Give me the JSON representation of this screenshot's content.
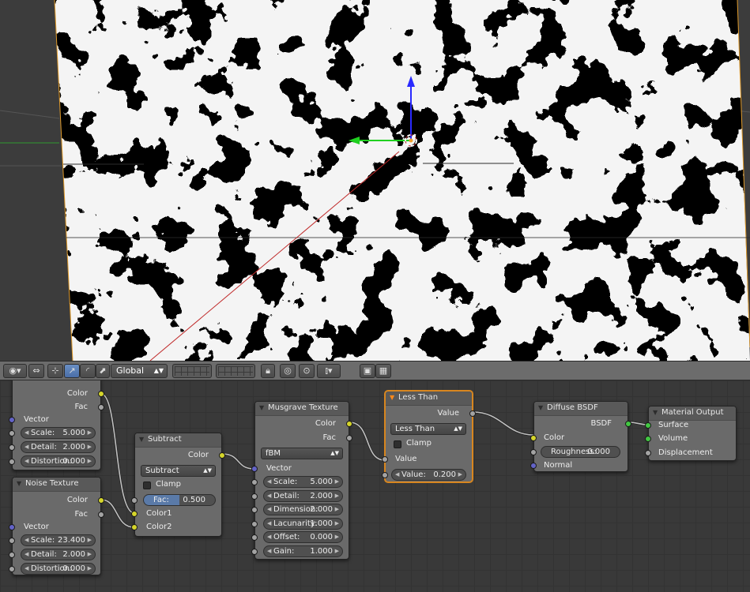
{
  "toolbar": {
    "orientation": "Global",
    "icons": [
      "viewport-shading-icon",
      "pivot-icon",
      "manipulator-toggle-icon",
      "translate-icon",
      "rotate-icon",
      "scale-icon",
      "layers-icon",
      "lock-icon",
      "proportional-edit-icon",
      "snap-icon",
      "render-icon",
      "anim-render-icon"
    ]
  },
  "nodes": {
    "noise1": {
      "title": "",
      "out_color": "Color",
      "out_fac": "Fac",
      "in_vector": "Vector",
      "scale_label": "Scale:",
      "scale": "5.000",
      "detail_label": "Detail:",
      "detail": "2.000",
      "distortion_label": "Distortion:",
      "distortion": "0.000"
    },
    "noise2": {
      "title": "Noise Texture",
      "out_color": "Color",
      "out_fac": "Fac",
      "in_vector": "Vector",
      "scale_label": "Scale:",
      "scale": "23.400",
      "detail_label": "Detail:",
      "detail": "2.000",
      "distortion_label": "Distortion:",
      "distortion": "0.000"
    },
    "subtract": {
      "title": "Subtract",
      "out_color": "Color",
      "mode": "Subtract",
      "clamp": "Clamp",
      "fac_label": "Fac:",
      "fac": "0.500",
      "in_color1": "Color1",
      "in_color2": "Color2"
    },
    "musgrave": {
      "title": "Musgrave Texture",
      "out_color": "Color",
      "out_fac": "Fac",
      "type": "fBM",
      "in_vector": "Vector",
      "scale_label": "Scale:",
      "scale": "5.000",
      "detail_label": "Detail:",
      "detail": "2.000",
      "dimension_label": "Dimension:",
      "dimension": "2.000",
      "lacunarity_label": "Lacunarity:",
      "lacunarity": "1.000",
      "offset_label": "Offset:",
      "offset": "0.000",
      "gain_label": "Gain:",
      "gain": "1.000"
    },
    "lessthan": {
      "title": "Less Than",
      "out_value": "Value",
      "mode": "Less Than",
      "clamp": "Clamp",
      "in_value": "Value",
      "value_label": "Value:",
      "value": "0.200"
    },
    "diffuse": {
      "title": "Diffuse BSDF",
      "out_bsdf": "BSDF",
      "in_color": "Color",
      "roughness_label": "Roughness:",
      "roughness": "0.000",
      "in_normal": "Normal"
    },
    "output": {
      "title": "Material Output",
      "in_surface": "Surface",
      "in_volume": "Volume",
      "in_displacement": "Displacement"
    }
  },
  "colors": {
    "active_node_border": "#d8861f",
    "socket_color": "#d5d52b",
    "socket_float": "#a3a3a3",
    "socket_vector": "#6363c7",
    "socket_shader": "#42c742"
  }
}
